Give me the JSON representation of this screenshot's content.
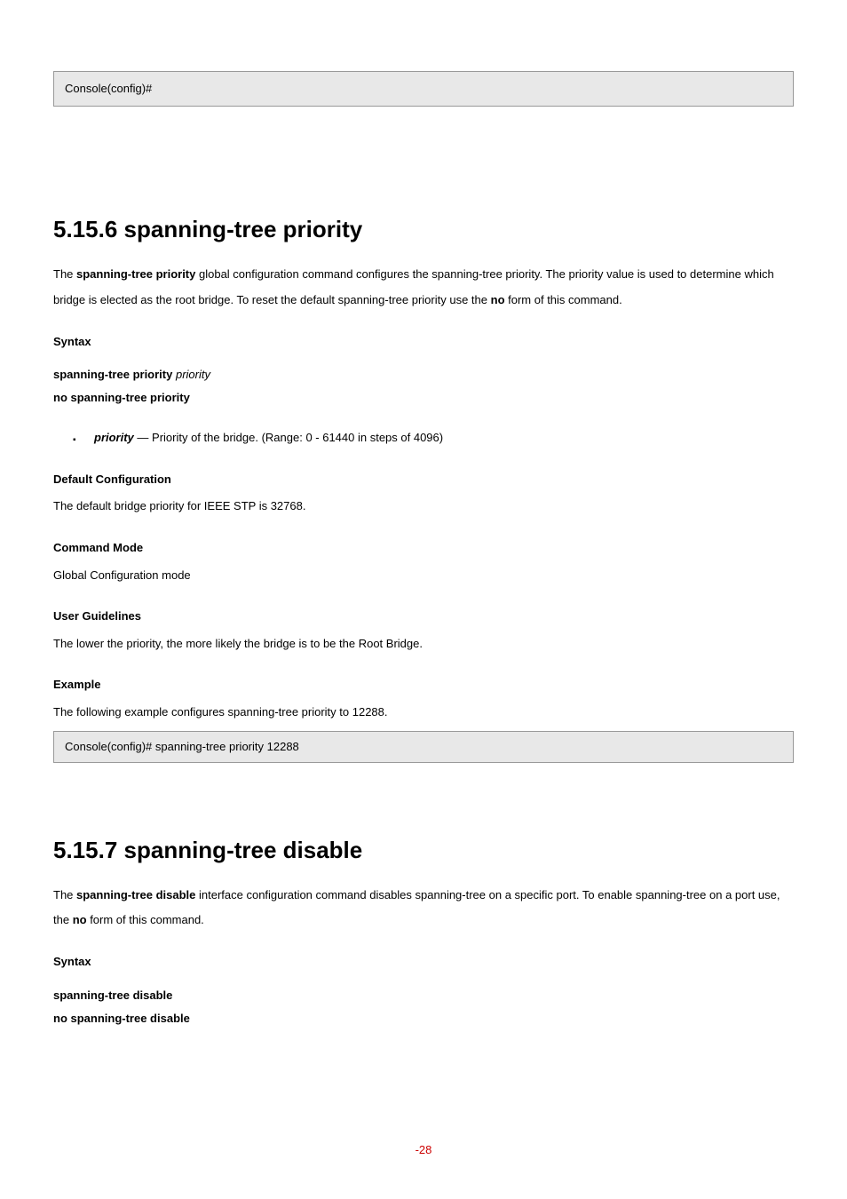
{
  "block1": {
    "prompt": "Console(config)#"
  },
  "section1": {
    "title": "5.15.6 spanning-tree priority",
    "desc1": "The ",
    "descBold1": "spanning-tree priority",
    "desc2": " global configuration command configures the spanning-tree priority. The priority value is used to determine which bridge is elected as the root bridge. To reset the default spanning-tree priority use the ",
    "descBold2": "no",
    "desc3": " form of this command.",
    "syntaxHeading": "Syntax",
    "syntax1a": "spanning-tree priority ",
    "syntax1b": "priority",
    "syntax2": "no spanning-tree priority",
    "paramName": "priority",
    "paramDesc": " — Priority of the bridge. (Range: 0 - 61440 in steps of 4096)",
    "defaultHeading": "Default Configuration",
    "defaultText": "The default bridge priority for IEEE STP is 32768.",
    "modeHeading": "Command Mode",
    "modeText": "Global Configuration mode",
    "guideHeading": "User Guidelines",
    "guideText": "The lower the priority, the more likely the bridge is to be the Root Bridge.",
    "exampleHeading": "Example",
    "exampleText": "The following example configures spanning-tree priority to 12288.",
    "examplePrompt": "Console(config)# ",
    "exampleCmd": "spanning-tree priority ",
    "exampleVal": "12288"
  },
  "section2": {
    "title": "5.15.7 spanning-tree disable",
    "desc1": "The ",
    "descBold1": "spanning-tree disable",
    "desc2a": " interface configuration command disables spanning-tree on a specific port. To enable spanning-tree on a port use, the ",
    "descBold2": "no",
    "desc3": " form of this command.",
    "syntaxHeading": "Syntax",
    "syntax1": "spanning-tree disable",
    "syntax2": "no spanning-tree disable"
  },
  "pageNum": "-28"
}
